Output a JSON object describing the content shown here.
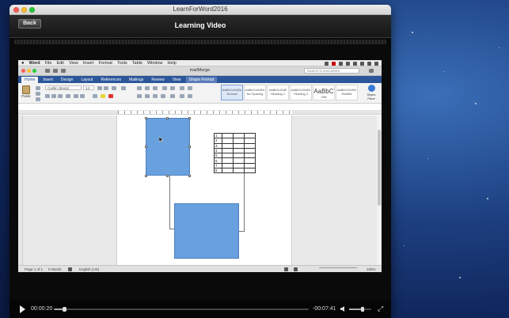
{
  "app": {
    "window_title": "LearnForWord2016",
    "back_label": "Back",
    "header_title": "Learning Video"
  },
  "mac_menu": {
    "apple": "",
    "items": [
      "Word",
      "File",
      "Edit",
      "View",
      "Insert",
      "Format",
      "Tools",
      "Table",
      "Window",
      "Help"
    ]
  },
  "word": {
    "doc_title": "mailMerge",
    "search_placeholder": "Search in Document",
    "tabs": [
      "Home",
      "Insert",
      "Design",
      "Layout",
      "References",
      "Mailings",
      "Review",
      "View",
      "Shape Format"
    ],
    "paste_label": "Paste",
    "font_name": "Calibri (Body)",
    "font_size": "14",
    "styles": [
      {
        "sample": "AaBbCcDdEe",
        "name": "Normal"
      },
      {
        "sample": "AaBbCcDdEe",
        "name": "No Spacing"
      },
      {
        "sample": "AaBbCcDdE",
        "name": "Heading 1"
      },
      {
        "sample": "AaBbCcDdEe",
        "name": "Heading 2"
      },
      {
        "sample": "AaBbC",
        "name": "Title"
      },
      {
        "sample": "AaBbCcDdEe",
        "name": "Subtitle"
      }
    ],
    "styles_pane_label": "Styles Pane",
    "table_rows": [
      "1",
      "2",
      "3",
      "4",
      "5",
      "6",
      "7",
      "8"
    ],
    "status": {
      "page": "Page 1 of 1",
      "words": "0 Words",
      "language": "English (US)",
      "zoom": "100%"
    }
  },
  "player": {
    "elapsed": "00:00:20",
    "remaining": "-00:07:41",
    "progress": 0.04,
    "volume": 0.6
  }
}
